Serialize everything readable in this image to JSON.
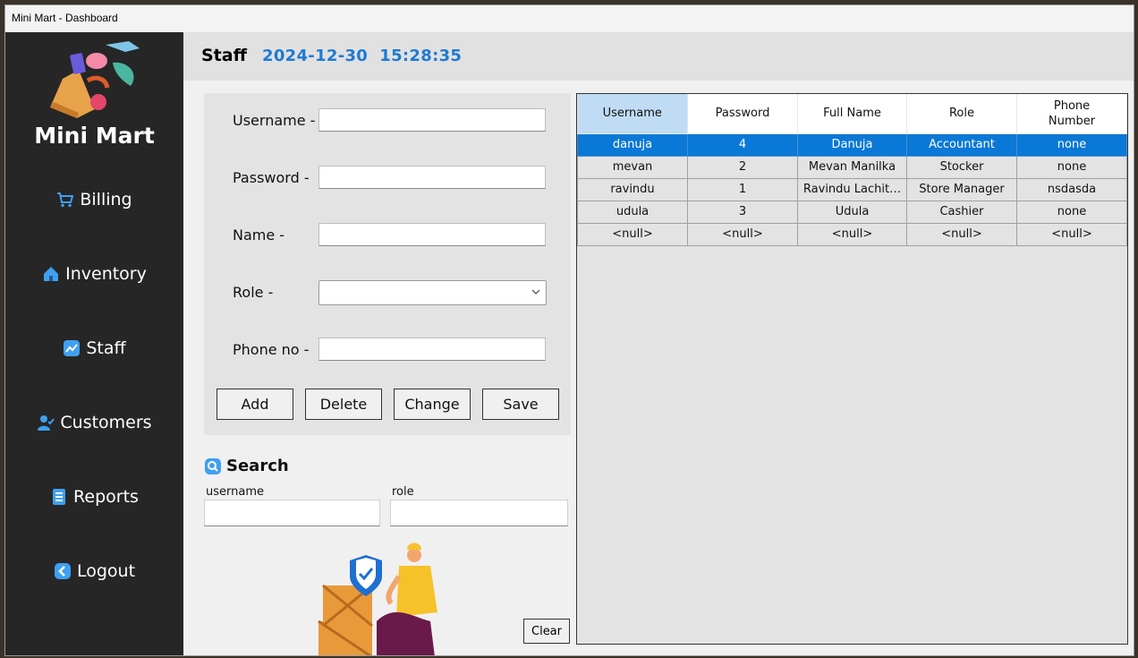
{
  "window": {
    "title": "Mini Mart - Dashboard"
  },
  "sidebar": {
    "brand": "Mini Mart",
    "items": [
      {
        "label": "Billing",
        "icon": "cart-icon"
      },
      {
        "label": "Inventory",
        "icon": "home-icon"
      },
      {
        "label": "Staff",
        "icon": "chart-icon"
      },
      {
        "label": "Customers",
        "icon": "user-icon"
      },
      {
        "label": "Reports",
        "icon": "report-icon"
      },
      {
        "label": "Logout",
        "icon": "back-icon"
      }
    ]
  },
  "header": {
    "title": "Staff",
    "date": "2024-12-30",
    "time": "15:28:35"
  },
  "form": {
    "username_label": "Username -",
    "password_label": "Password -",
    "name_label": "Name -",
    "role_label": "Role -",
    "phone_label": "Phone no -",
    "username_value": "",
    "password_value": "",
    "name_value": "",
    "role_value": "",
    "phone_value": "",
    "buttons": {
      "add": "Add",
      "delete": "Delete",
      "change": "Change",
      "save": "Save"
    }
  },
  "search": {
    "title": "Search",
    "username_label": "username",
    "role_label": "role",
    "username_value": "",
    "role_value": "",
    "clear": "Clear"
  },
  "table": {
    "headers": [
      "Username",
      "Password",
      "Full Name",
      "Role",
      "Phone\nNumber"
    ],
    "rows": [
      [
        "danuja",
        "4",
        "Danuja",
        "Accountant",
        "none"
      ],
      [
        "mevan",
        "2",
        "Mevan Manilka",
        "Stocker",
        "none"
      ],
      [
        "ravindu",
        "1",
        "Ravindu Lachit…",
        "Store Manager",
        "nsdasda"
      ],
      [
        "udula",
        "3",
        "Udula",
        "Cashier",
        "none"
      ],
      [
        "<null>",
        "<null>",
        "<null>",
        "<null>",
        "<null>"
      ]
    ],
    "selected_row": 0
  },
  "colors": {
    "sidebar": "#262626",
    "accent": "#1f7ad4",
    "selection": "#0a78d7"
  }
}
